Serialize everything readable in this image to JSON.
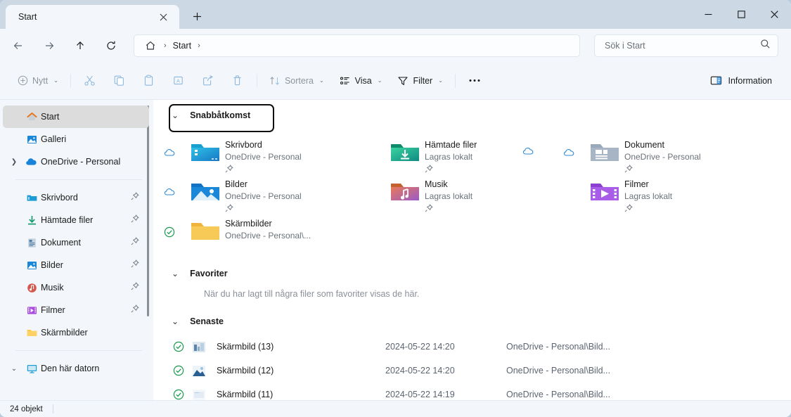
{
  "window": {
    "tab_title": "Start",
    "new_tab_icon": "plus-icon",
    "close_tab_icon": "close-icon",
    "minimize_icon": "minimize-icon",
    "maximize_icon": "maximize-icon",
    "close_icon": "close-icon",
    "accent": "#0f6cbd",
    "titlebar_color": "#ccd9e5",
    "chrome_color": "#f3f7fb"
  },
  "nav": {
    "back_icon": "arrow-left-icon",
    "forward_icon": "arrow-right-icon",
    "up_icon": "arrow-up-icon",
    "refresh_icon": "refresh-icon",
    "breadcrumb": {
      "home_icon": "home-icon",
      "sep": "›",
      "crumb": "Start",
      "trailing_sep": "›"
    }
  },
  "search": {
    "placeholder": "Sök i Start",
    "icon": "search-icon"
  },
  "toolbar": {
    "new_label": "Nytt",
    "new_icon": "plus-circle-icon",
    "cut_icon": "scissors-icon",
    "copy_icon": "copy-icon",
    "paste_icon": "paste-icon",
    "rename_icon": "rename-icon",
    "share_icon": "share-icon",
    "delete_icon": "trash-icon",
    "sort_label": "Sortera",
    "sort_icon": "sort-icon",
    "view_label": "Visa",
    "view_icon": "view-icon",
    "filter_label": "Filter",
    "filter_icon": "funnel-icon",
    "more_icon": "ellipsis-icon",
    "details_label": "Information",
    "details_icon": "details-pane-icon",
    "chevron": "⌄"
  },
  "sidebar": {
    "groups": [
      {
        "items": [
          {
            "label": "Start",
            "icon": "home-icon",
            "selected": true,
            "expandable": false,
            "pinned": false
          },
          {
            "label": "Galleri",
            "icon": "gallery-icon",
            "selected": false,
            "expandable": false,
            "pinned": false
          },
          {
            "label": "OneDrive - Personal",
            "icon": "onedrive-icon",
            "selected": false,
            "expandable": true,
            "pinned": false
          }
        ]
      },
      {
        "items": [
          {
            "label": "Skrivbord",
            "icon": "desktop-folder-icon",
            "selected": false,
            "expandable": false,
            "pinned": true
          },
          {
            "label": "Hämtade filer",
            "icon": "downloads-icon",
            "selected": false,
            "expandable": false,
            "pinned": true
          },
          {
            "label": "Dokument",
            "icon": "documents-folder-icon",
            "selected": false,
            "expandable": false,
            "pinned": true
          },
          {
            "label": "Bilder",
            "icon": "pictures-folder-icon",
            "selected": false,
            "expandable": false,
            "pinned": true
          },
          {
            "label": "Musik",
            "icon": "music-folder-icon",
            "selected": false,
            "expandable": false,
            "pinned": true
          },
          {
            "label": "Filmer",
            "icon": "videos-folder-icon",
            "selected": false,
            "expandable": false,
            "pinned": true
          },
          {
            "label": "Skärmbilder",
            "icon": "folder-icon",
            "selected": false,
            "expandable": false,
            "pinned": false
          }
        ]
      },
      {
        "items": [
          {
            "label": "Den här datorn",
            "icon": "this-pc-icon",
            "selected": false,
            "expandable": true,
            "expanded": true,
            "pinned": false
          }
        ]
      }
    ]
  },
  "content": {
    "quick_access": {
      "title": "Snabbåtkomst",
      "chevron": "⌄",
      "focused": true,
      "tiles": [
        {
          "name": "Skrivbord",
          "sub": "OneDrive - Personal",
          "icon": "desktop-folder-icon",
          "status": "cloud-icon",
          "pinned": true
        },
        {
          "name": "Hämtade filer",
          "sub": "Lagras lokalt",
          "icon": "downloads-folder-icon",
          "status": "cloud-icon",
          "pinned": true
        },
        {
          "name": "Dokument",
          "sub": "OneDrive - Personal",
          "icon": "documents-folder-icon",
          "status": "cloud-icon",
          "pinned": true
        },
        {
          "name": "Bilder",
          "sub": "OneDrive - Personal",
          "icon": "pictures-folder-icon",
          "status": "cloud-icon",
          "pinned": true
        },
        {
          "name": "Musik",
          "sub": "Lagras lokalt",
          "icon": "music-folder-icon",
          "status": "none",
          "pinned": true
        },
        {
          "name": "Filmer",
          "sub": "Lagras lokalt",
          "icon": "videos-folder-icon",
          "status": "none",
          "pinned": true
        },
        {
          "name": "Skärmbilder",
          "sub": "OneDrive - Personal\\...",
          "icon": "folder-icon",
          "status": "synced-check-icon",
          "pinned": false
        }
      ]
    },
    "favorites": {
      "title": "Favoriter",
      "chevron": "⌄",
      "empty_text": "När du har lagt till några filer som favoriter visas de här."
    },
    "recent": {
      "title": "Senaste",
      "chevron": "⌄",
      "rows": [
        {
          "name": "Skärmbild (13)",
          "date": "2024-05-22 14:20",
          "path": "OneDrive - Personal\\Bild...",
          "status": "synced-check-icon",
          "thumb": "image-thumb-icon"
        },
        {
          "name": "Skärmbild (12)",
          "date": "2024-05-22 14:20",
          "path": "OneDrive - Personal\\Bild...",
          "status": "synced-check-icon",
          "thumb": "image-thumb-icon"
        },
        {
          "name": "Skärmbild (11)",
          "date": "2024-05-22 14:19",
          "path": "OneDrive - Personal\\Bild...",
          "status": "synced-check-icon",
          "thumb": "image-thumb-icon"
        }
      ]
    }
  },
  "statusbar": {
    "item_count": "24 objekt"
  }
}
